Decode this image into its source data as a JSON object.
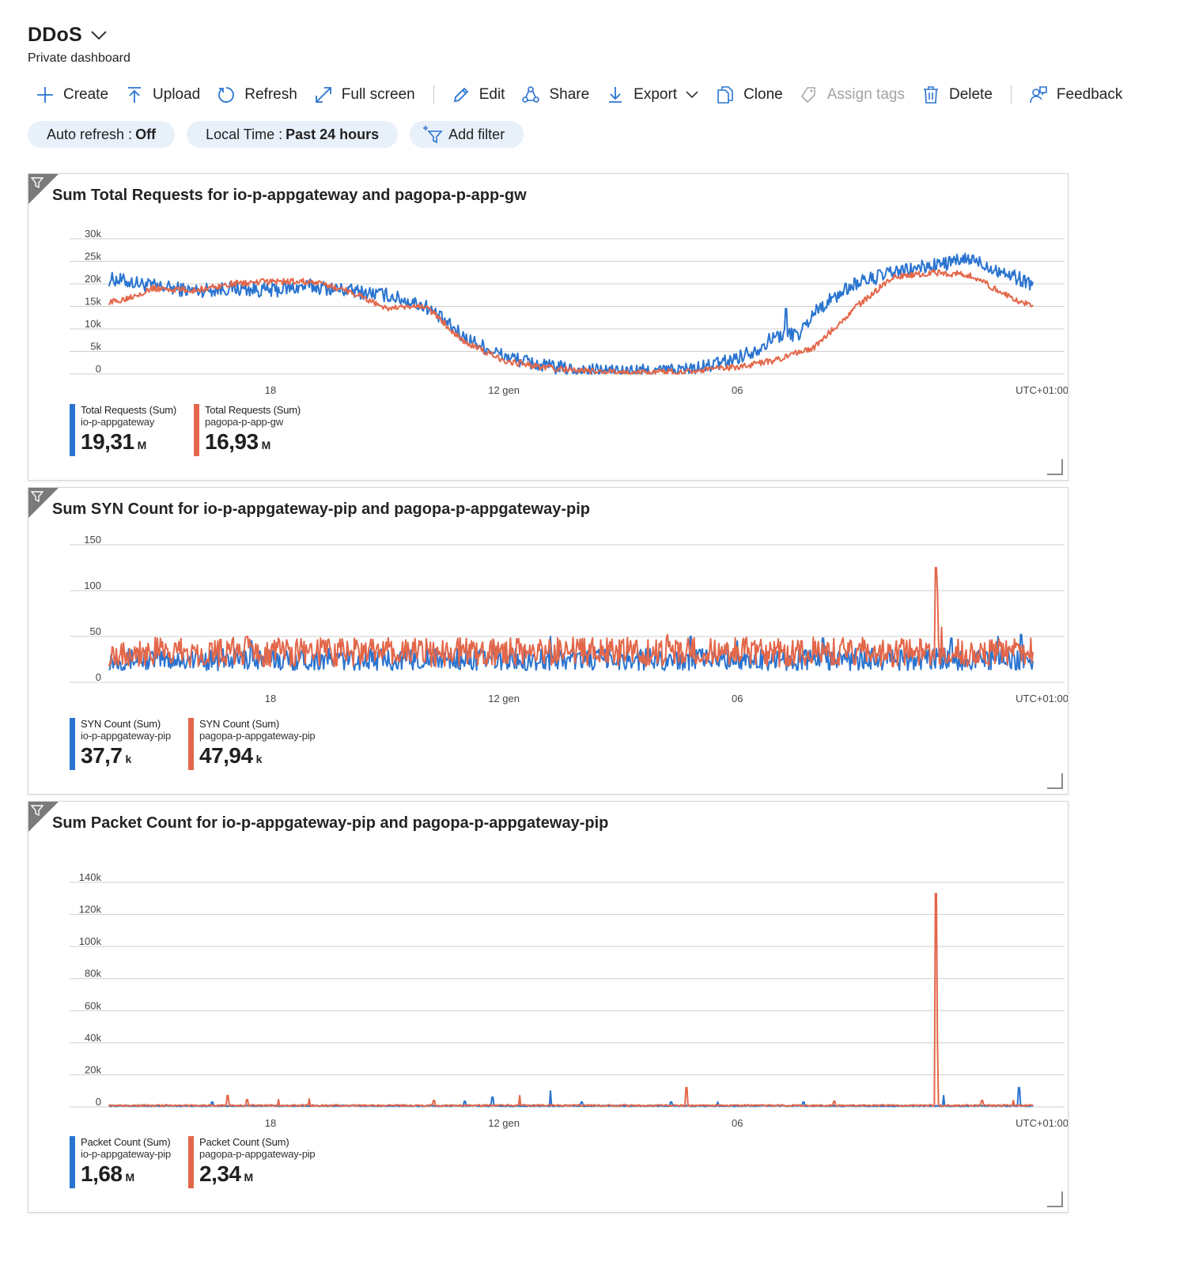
{
  "header": {
    "title": "DDoS",
    "subtitle": "Private dashboard"
  },
  "toolbar": {
    "create": "Create",
    "upload": "Upload",
    "refresh": "Refresh",
    "fullscreen": "Full screen",
    "edit": "Edit",
    "share": "Share",
    "export": "Export",
    "clone": "Clone",
    "assign_tags": "Assign tags",
    "delete": "Delete",
    "feedback": "Feedback"
  },
  "filters": {
    "auto_refresh_label": "Auto refresh :",
    "auto_refresh_value": "Off",
    "time_label": "Local Time :",
    "time_value": "Past 24 hours",
    "add_filter": "Add filter"
  },
  "colors": {
    "series1": "#2a74d0",
    "series2": "#e3674a",
    "pill_bg": "#e8f0fa"
  },
  "chart_data": [
    {
      "type": "line",
      "title": "Sum Total Requests for io-p-appgateway and pagopa-p-app-gw",
      "x_ticks": [
        "18",
        "12 gen",
        "06"
      ],
      "x_tick_hours": [
        18,
        24,
        30
      ],
      "x_start_hour": 13.75,
      "x_end_hour": 37.6,
      "timezone_label": "UTC+01:00",
      "y_ticks": [
        "30k",
        "25k",
        "20k",
        "15k",
        "10k",
        "5k",
        "0"
      ],
      "ylim": [
        0,
        30000
      ],
      "series": [
        {
          "name": "Total Requests (Sum)",
          "resource": "io-p-appgateway",
          "total": "19,31",
          "unit": "M",
          "color": "#2a74d0",
          "noise": 1600,
          "keyframes": [
            [
              14,
              21000
            ],
            [
              15,
              19500
            ],
            [
              16,
              18500
            ],
            [
              17,
              19000
            ],
            [
              18,
              18500
            ],
            [
              19,
              19500
            ],
            [
              20,
              18500
            ],
            [
              21,
              17500
            ],
            [
              22,
              15000
            ],
            [
              23,
              8000
            ],
            [
              24,
              4000
            ],
            [
              25,
              1800
            ],
            [
              26,
              800
            ],
            [
              27,
              500
            ],
            [
              28,
              700
            ],
            [
              29,
              1200
            ],
            [
              29.8,
              3000
            ],
            [
              30.5,
              5500
            ],
            [
              31,
              8500
            ],
            [
              31.6,
              9000
            ],
            [
              32,
              14000
            ],
            [
              33,
              20000
            ],
            [
              34,
              22500
            ],
            [
              35,
              24000
            ],
            [
              36,
              25500
            ],
            [
              37,
              22000
            ],
            [
              37.6,
              20000
            ]
          ],
          "spikes": [
            [
              31.25,
              14500
            ],
            [
              31.8,
              12000
            ]
          ]
        },
        {
          "name": "Total Requests (Sum)",
          "resource": "pagopa-p-app-gw",
          "total": "16,93",
          "unit": "M",
          "color": "#e3674a",
          "noise": 700,
          "keyframes": [
            [
              14,
              16000
            ],
            [
              15,
              19000
            ],
            [
              16,
              18500
            ],
            [
              17,
              20000
            ],
            [
              18,
              20500
            ],
            [
              19,
              20500
            ],
            [
              20,
              18500
            ],
            [
              21,
              14500
            ],
            [
              22,
              15000
            ],
            [
              23,
              7000
            ],
            [
              24,
              3000
            ],
            [
              25,
              1500
            ],
            [
              26,
              700
            ],
            [
              27,
              300
            ],
            [
              28,
              400
            ],
            [
              29,
              800
            ],
            [
              30,
              1500
            ],
            [
              31,
              3000
            ],
            [
              32,
              6000
            ],
            [
              33,
              14500
            ],
            [
              34,
              21500
            ],
            [
              35,
              22500
            ],
            [
              36,
              22000
            ],
            [
              37,
              17000
            ],
            [
              37.6,
              15000
            ]
          ],
          "spikes": []
        }
      ]
    },
    {
      "type": "line",
      "title": "Sum SYN Count for io-p-appgateway-pip and pagopa-p-appgateway-pip",
      "x_ticks": [
        "18",
        "12 gen",
        "06"
      ],
      "x_tick_hours": [
        18,
        24,
        30
      ],
      "x_start_hour": 13.75,
      "x_end_hour": 37.6,
      "timezone_label": "UTC+01:00",
      "y_ticks": [
        "150",
        "100",
        "50",
        "0"
      ],
      "ylim": [
        0,
        150
      ],
      "series": [
        {
          "name": "SYN Count (Sum)",
          "resource": "io-p-appgateway-pip",
          "total": "37,7",
          "unit": "k",
          "color": "#2a74d0",
          "noise": 12,
          "keyframes": [
            [
              14,
              25
            ],
            [
              37.6,
              25
            ]
          ],
          "spikes": [
            [
              17.5,
              45
            ],
            [
              25.2,
              50
            ],
            [
              28.8,
              50
            ],
            [
              30,
              45
            ],
            [
              32.2,
              48
            ],
            [
              35.5,
              48
            ],
            [
              36.7,
              50
            ],
            [
              37.3,
              52
            ]
          ]
        },
        {
          "name": "SYN Count (Sum)",
          "resource": "pagopa-p-appgateway-pip",
          "total": "47,94",
          "unit": "k",
          "color": "#e3674a",
          "noise": 16,
          "keyframes": [
            [
              14,
              33
            ],
            [
              37.6,
              33
            ]
          ],
          "spikes": [
            [
              17.4,
              50
            ],
            [
              18.2,
              48
            ],
            [
              28.2,
              52
            ],
            [
              35.1,
              125
            ],
            [
              35.15,
              100
            ],
            [
              35.25,
              60
            ]
          ]
        }
      ]
    },
    {
      "type": "line",
      "title": "Sum Packet Count for io-p-appgateway-pip and pagopa-p-appgateway-pip",
      "x_ticks": [
        "18",
        "12 gen",
        "06"
      ],
      "x_tick_hours": [
        18,
        24,
        30
      ],
      "x_start_hour": 13.75,
      "x_end_hour": 37.6,
      "timezone_label": "UTC+01:00",
      "y_ticks": [
        "140k",
        "120k",
        "100k",
        "80k",
        "60k",
        "40k",
        "20k",
        "0"
      ],
      "ylim": [
        0,
        140000
      ],
      "series": [
        {
          "name": "Packet Count (Sum)",
          "resource": "io-p-appgateway-pip",
          "total": "1,68",
          "unit": "M",
          "color": "#2a74d0",
          "noise": 400,
          "keyframes": [
            [
              14,
              600
            ],
            [
              37.6,
              600
            ]
          ],
          "spikes": [
            [
              16.5,
              3000
            ],
            [
              23,
              3500
            ],
            [
              23.7,
              6000
            ],
            [
              25.2,
              10000
            ],
            [
              26,
              3000
            ],
            [
              28.3,
              3000
            ],
            [
              29.5,
              3000
            ],
            [
              31.7,
              3000
            ],
            [
              35.3,
              7000
            ],
            [
              37.25,
              12000
            ]
          ]
        },
        {
          "name": "Packet Count (Sum)",
          "resource": "pagopa-p-appgateway-pip",
          "total": "2,34",
          "unit": "M",
          "color": "#e3674a",
          "noise": 500,
          "keyframes": [
            [
              14,
              900
            ],
            [
              37.6,
              900
            ]
          ],
          "spikes": [
            [
              16.9,
              7000
            ],
            [
              17.4,
              4500
            ],
            [
              18.2,
              4500
            ],
            [
              19,
              5000
            ],
            [
              22.2,
              4000
            ],
            [
              24.4,
              7000
            ],
            [
              28.7,
              12000
            ],
            [
              32.5,
              3500
            ],
            [
              35.1,
              133000
            ],
            [
              35.15,
              40000
            ],
            [
              36.3,
              4000
            ],
            [
              37.1,
              4000
            ]
          ]
        }
      ]
    }
  ]
}
